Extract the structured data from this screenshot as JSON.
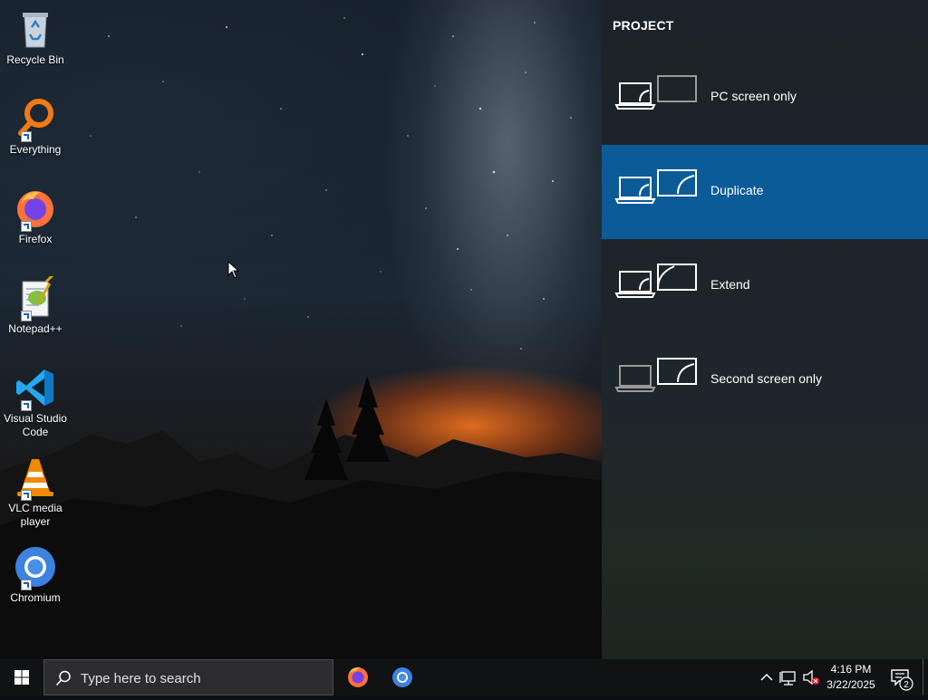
{
  "desktop": {
    "icons": [
      {
        "label": "Recycle Bin",
        "icon": "recycle-bin-icon"
      },
      {
        "label": "Everything",
        "icon": "everything-search-icon"
      },
      {
        "label": "Firefox",
        "icon": "firefox-icon"
      },
      {
        "label": "Notepad++",
        "icon": "notepad-plus-plus-icon"
      },
      {
        "label": "Visual Studio Code",
        "icon": "vscode-icon"
      },
      {
        "label": "VLC media player",
        "icon": "vlc-icon"
      },
      {
        "label": "Chromium",
        "icon": "chromium-icon"
      }
    ]
  },
  "project_panel": {
    "title": "PROJECT",
    "options": [
      {
        "label": "PC screen only",
        "selected": false
      },
      {
        "label": "Duplicate",
        "selected": true
      },
      {
        "label": "Extend",
        "selected": false
      },
      {
        "label": "Second screen only",
        "selected": false
      }
    ]
  },
  "taskbar": {
    "search_placeholder": "Type here to search",
    "pinned": [
      "firefox-icon",
      "chromium-icon"
    ],
    "tray_icons": [
      "chevron-up-icon",
      "network-icon",
      "volume-muted-icon"
    ],
    "time": "4:16 PM",
    "date": "3/22/2025",
    "notification_count": "2"
  },
  "colors": {
    "selected_option": "#0c5b99",
    "taskbar": "#101214"
  }
}
